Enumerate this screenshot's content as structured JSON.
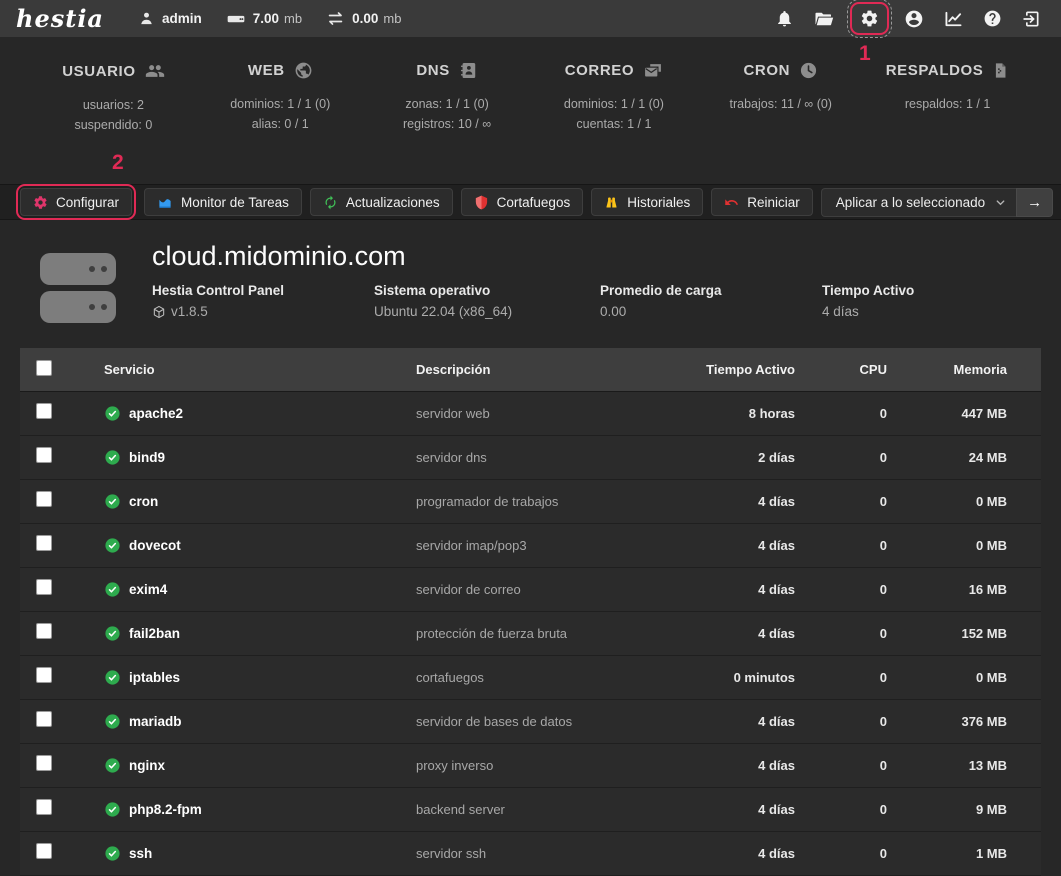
{
  "topbar": {
    "logo": "hestia",
    "user": "admin",
    "disk": {
      "value": "7.00",
      "unit": "mb"
    },
    "bandwidth": {
      "value": "0.00",
      "unit": "mb"
    },
    "icons": [
      "user-icon",
      "hdd-icon",
      "transfer-icon",
      "bell-icon",
      "file-manager-icon",
      "settings-icon",
      "account-icon",
      "statistics-icon",
      "help-icon",
      "logout-icon"
    ]
  },
  "annotations": {
    "step1": "1",
    "step2": "2",
    "accent_color": "#e02a55"
  },
  "stats": [
    {
      "title": "USUARIO",
      "icon": "users-icon",
      "line1": "usuarios: 2",
      "line2": "suspendido: 0"
    },
    {
      "title": "WEB",
      "icon": "globe-icon",
      "line1": "dominios: 1 / 1 (0)",
      "line2": "alias: 0 / 1"
    },
    {
      "title": "DNS",
      "icon": "dns-book-icon",
      "line1": "zonas: 1 / 1 (0)",
      "line2": "registros: 10 / ∞"
    },
    {
      "title": "CORREO",
      "icon": "mail-icon",
      "line1": "dominios: 1 / 1 (0)",
      "line2": "cuentas: 1 / 1"
    },
    {
      "title": "CRON",
      "icon": "clock-icon",
      "line1": "trabajos: 11 / ∞ (0)",
      "line2": ""
    },
    {
      "title": "RESPALDOS",
      "icon": "backup-icon",
      "line1": "respaldos: 1 / 1",
      "line2": ""
    }
  ],
  "toolbar": {
    "buttons": [
      {
        "label": "Configurar",
        "icon": "gear-icon",
        "icon_color": "#e0356b"
      },
      {
        "label": "Monitor de Tareas",
        "icon": "area-chart-icon",
        "icon_color": "#339af0"
      },
      {
        "label": "Actualizaciones",
        "icon": "refresh-icon",
        "icon_color": "#40c057"
      },
      {
        "label": "Cortafuegos",
        "icon": "shield-icon",
        "icon_color": "#e03131"
      },
      {
        "label": "Historiales",
        "icon": "binoculars-icon",
        "icon_color": "#fcc419"
      },
      {
        "label": "Reiniciar",
        "icon": "restart-icon",
        "icon_color": "#e03131"
      }
    ],
    "apply_select": "Aplicar a lo seleccionado",
    "apply_arrow": "→"
  },
  "server": {
    "hostname": "cloud.midominio.com",
    "info": [
      {
        "label": "Hestia Control Panel",
        "value": "v1.8.5"
      },
      {
        "label": "Sistema operativo",
        "value": "Ubuntu 22.04 (x86_64)"
      },
      {
        "label": "Promedio de carga",
        "value": "0.00"
      },
      {
        "label": "Tiempo Activo",
        "value": "4 días"
      }
    ]
  },
  "table": {
    "headers": [
      "Servicio",
      "Descripción",
      "Tiempo Activo",
      "CPU",
      "Memoria"
    ],
    "status_color": "#2eab4e",
    "rows": [
      {
        "name": "apache2",
        "desc": "servidor web",
        "uptime": "8 horas",
        "cpu": "0",
        "mem": "447 MB"
      },
      {
        "name": "bind9",
        "desc": "servidor dns",
        "uptime": "2 días",
        "cpu": "0",
        "mem": "24 MB"
      },
      {
        "name": "cron",
        "desc": "programador de trabajos",
        "uptime": "4 días",
        "cpu": "0",
        "mem": "0 MB"
      },
      {
        "name": "dovecot",
        "desc": "servidor imap/pop3",
        "uptime": "4 días",
        "cpu": "0",
        "mem": "0 MB"
      },
      {
        "name": "exim4",
        "desc": "servidor de correo",
        "uptime": "4 días",
        "cpu": "0",
        "mem": "16 MB"
      },
      {
        "name": "fail2ban",
        "desc": "protección de fuerza bruta",
        "uptime": "4 días",
        "cpu": "0",
        "mem": "152 MB"
      },
      {
        "name": "iptables",
        "desc": "cortafuegos",
        "uptime": "0 minutos",
        "cpu": "0",
        "mem": "0 MB"
      },
      {
        "name": "mariadb",
        "desc": "servidor de bases de datos",
        "uptime": "4 días",
        "cpu": "0",
        "mem": "376 MB"
      },
      {
        "name": "nginx",
        "desc": "proxy inverso",
        "uptime": "4 días",
        "cpu": "0",
        "mem": "13 MB"
      },
      {
        "name": "php8.2-fpm",
        "desc": "backend server",
        "uptime": "4 días",
        "cpu": "0",
        "mem": "9 MB"
      },
      {
        "name": "ssh",
        "desc": "servidor ssh",
        "uptime": "4 días",
        "cpu": "0",
        "mem": "1 MB"
      }
    ]
  }
}
